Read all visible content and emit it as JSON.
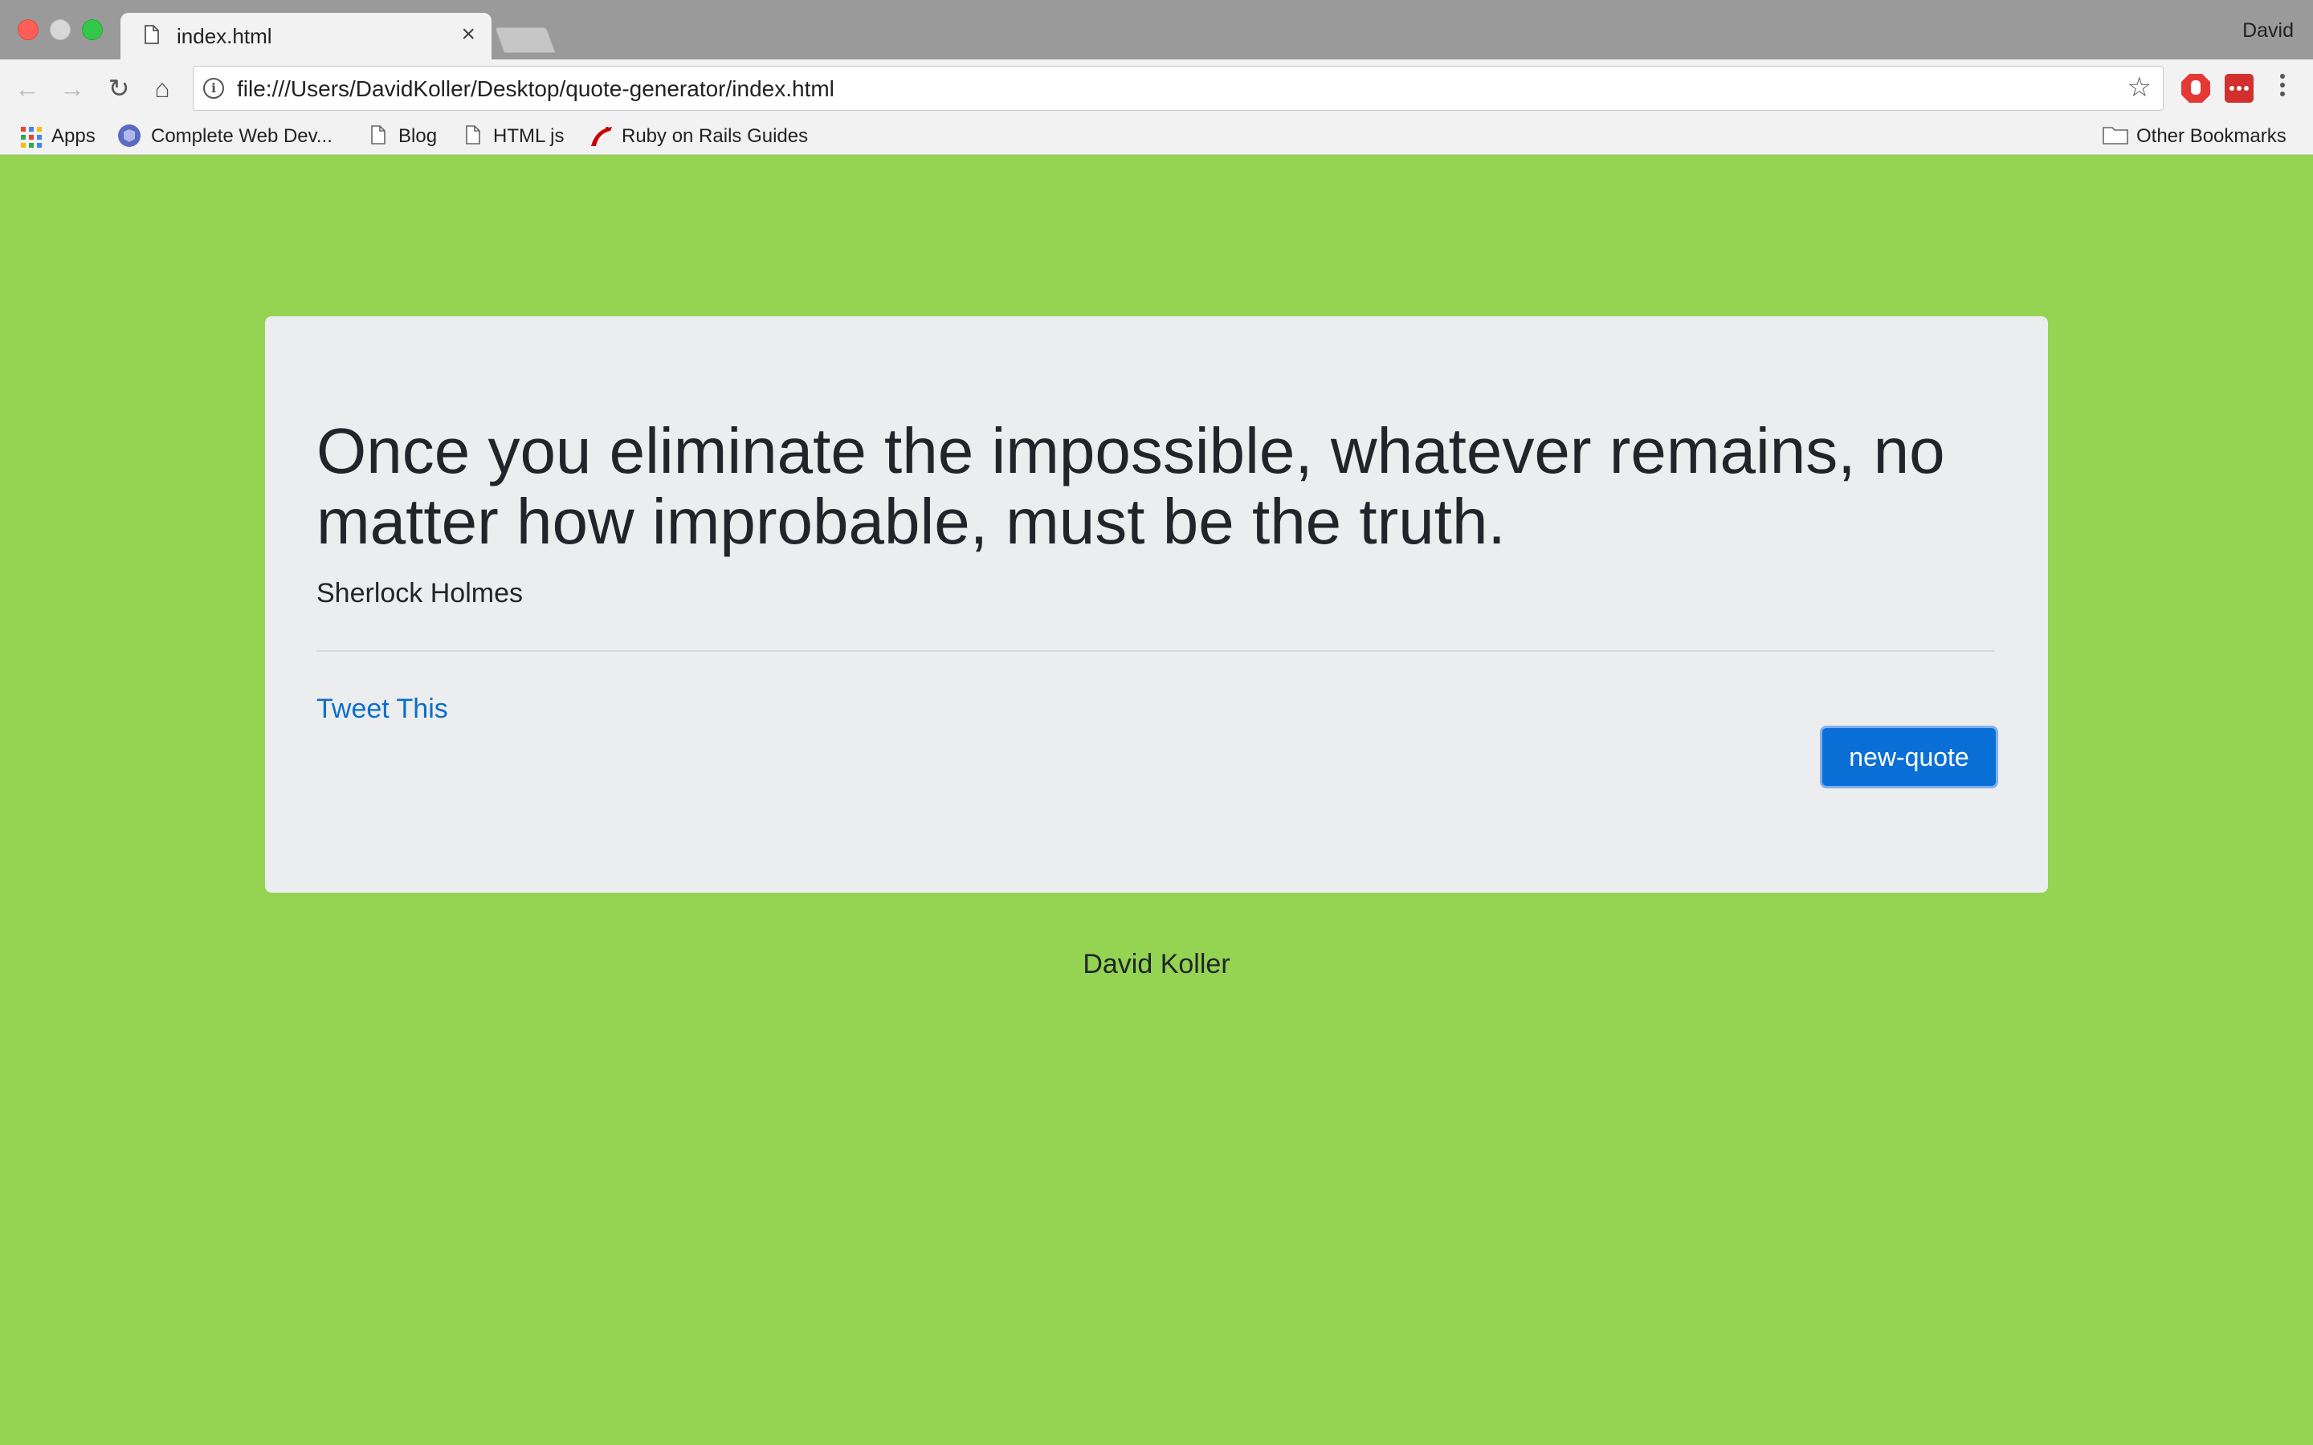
{
  "browser": {
    "tab_title": "index.html",
    "tab_close": "×",
    "profile_name": "David",
    "url": "file:///Users/DavidKoller/Desktop/quote-generator/index.html",
    "nav": {
      "back_icon": "←",
      "forward_icon": "→",
      "reload_icon": "↻",
      "home_icon": "⌂",
      "info_icon": "i",
      "star_icon": "☆"
    },
    "bookmarks": [
      {
        "label": "Apps",
        "icon": "apps-grid-icon"
      },
      {
        "label": "Complete Web Dev...",
        "icon": "course-icon"
      },
      {
        "label": "Blog",
        "icon": "page-icon"
      },
      {
        "label": "HTML js",
        "icon": "page-icon"
      },
      {
        "label": "Ruby on Rails Guides",
        "icon": "rails-icon"
      }
    ],
    "other_bookmarks": "Other Bookmarks"
  },
  "page": {
    "quote": "Once you eliminate the impossible, whatever remains, no matter how improbable, must be the truth.",
    "author": "Sherlock Holmes",
    "tweet_link": "Tweet This",
    "new_quote_button": "new-quote",
    "footer": "David Koller"
  },
  "colors": {
    "background": "#94d452",
    "card": "#ecedef",
    "link": "#0b6fc9",
    "button": "#0b6fd8"
  }
}
